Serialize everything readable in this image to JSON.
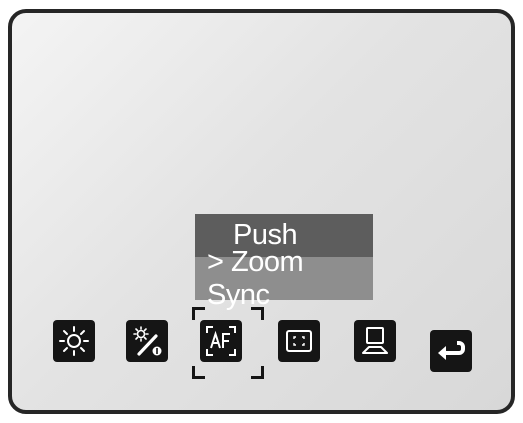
{
  "focus_menu": {
    "options": [
      {
        "label": "Push"
      },
      {
        "label": "> Zoom Sync"
      }
    ]
  },
  "toolbar": {
    "icons": [
      {
        "name": "brightness-icon"
      },
      {
        "name": "white-balance-icon"
      },
      {
        "name": "autofocus-icon"
      },
      {
        "name": "aspect-ratio-icon"
      },
      {
        "name": "image-flip-icon"
      },
      {
        "name": "return-icon"
      }
    ]
  },
  "colors": {
    "bezel": "#262626",
    "icon_bg": "#151515",
    "menu_selected_bg": "#5d5d5d",
    "menu_option_bg": "#8e8e8e",
    "menu_text": "#ffffff"
  }
}
